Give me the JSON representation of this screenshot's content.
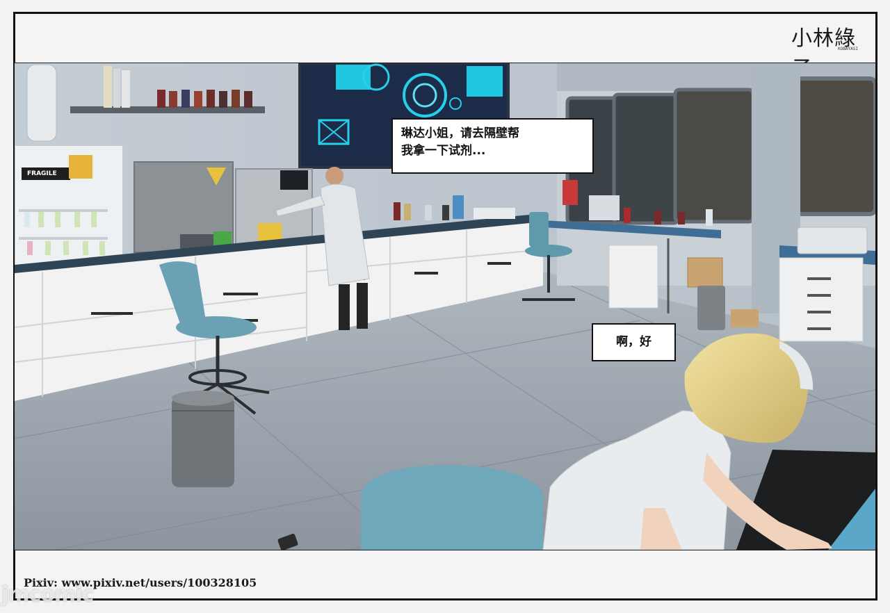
{
  "logo": {
    "main": "小林綠子",
    "sub": "KOBAYASI"
  },
  "panel": {
    "signs": [
      "FRAGILE"
    ],
    "dialogue": [
      {
        "speaker": "scientist",
        "text": "琳达小姐，请去隔壁帮\n我拿一下试剂..."
      },
      {
        "speaker": "nurse",
        "text": "啊，好"
      }
    ]
  },
  "footer": {
    "credit": "Pixiv: www.pixiv.net/users/100328105"
  },
  "watermark": {
    "text": "jmcomic"
  },
  "colors": {
    "frame": "#111111",
    "page": "#f4f4f4",
    "bubble": "#ffffff",
    "screen": "#1fc8e0"
  }
}
